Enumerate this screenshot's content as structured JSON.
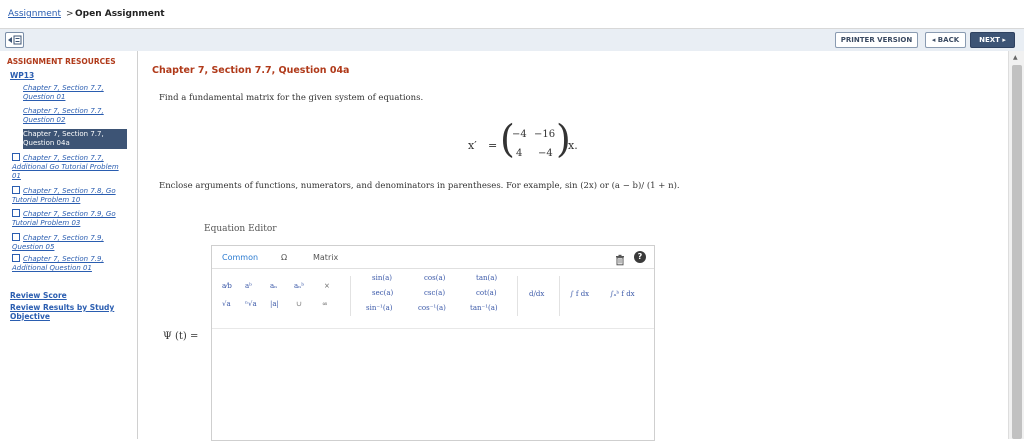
{
  "breadcrumb": {
    "parent": "Assignment",
    "separator": ">",
    "current": "Open Assignment"
  },
  "toolbar": {
    "printer": "PRINTER VERSION",
    "back": "◂ BACK",
    "next": "NEXT ▸"
  },
  "sidebar": {
    "resources_title": "ASSIGNMENT RESOURCES",
    "wp_title": "WP13",
    "items": [
      {
        "label": "Chapter 7, Section 7.7, Question 01"
      },
      {
        "label": "Chapter 7, Section 7.7, Question 02"
      },
      {
        "label": "Chapter 7, Section 7.7, Question 04a"
      },
      {
        "label": "Chapter 7, Section 7.7, Additional Go Tutorial Problem 01"
      },
      {
        "label": "Chapter 7, Section 7.8, Go Tutorial Problem 10"
      },
      {
        "label": "Chapter 7, Section 7.9, Go Tutorial Problem 03"
      },
      {
        "label": "Chapter 7, Section 7.9, Question 05"
      },
      {
        "label": "Chapter 7, Section 7.9, Additional Question 01"
      }
    ],
    "review_score": "Review Score",
    "review_results": "Review Results by Study Objective"
  },
  "question": {
    "title": "Chapter 7, Section 7.7, Question 04a",
    "prompt": "Find a fundamental matrix for the given system of equations.",
    "equation": {
      "lhs": "x′",
      "eq": "=",
      "m11": "−4",
      "m12": "−16",
      "m21": "4",
      "m22": "−4",
      "tail": "x."
    },
    "instructions": "Enclose arguments of functions, numerators, and denominators in parentheses. For example, sin (2x) or (a − b)/ (1 + n)."
  },
  "editor": {
    "label": "Equation Editor",
    "tabs": [
      "Common",
      "Ω",
      "Matrix"
    ],
    "help": "?",
    "psi_label": "Ψ (t) =",
    "palette": {
      "frac": "a⁄b",
      "pow": "aᵇ",
      "sub": "aₙ",
      "subsup": "aₙᵇ",
      "times": "×",
      "sqrt": "√a",
      "nroot": "ⁿ√a",
      "abs": "|a|",
      "union": "∪",
      "inf": "∞",
      "sin": "sin(a)",
      "cos": "cos(a)",
      "tan": "tan(a)",
      "sec": "sec(a)",
      "csc": "csc(a)",
      "cot": "cot(a)",
      "asin": "sin⁻¹(a)",
      "acos": "cos⁻¹(a)",
      "atan": "tan⁻¹(a)",
      "deriv": "d/dx",
      "integral": "∫ f dx",
      "defint": "∫ₐᵇ f dx"
    }
  },
  "colors": {
    "accent": "#b03a1a",
    "link": "#2a5db0",
    "nav_selected": "#3d5475"
  }
}
